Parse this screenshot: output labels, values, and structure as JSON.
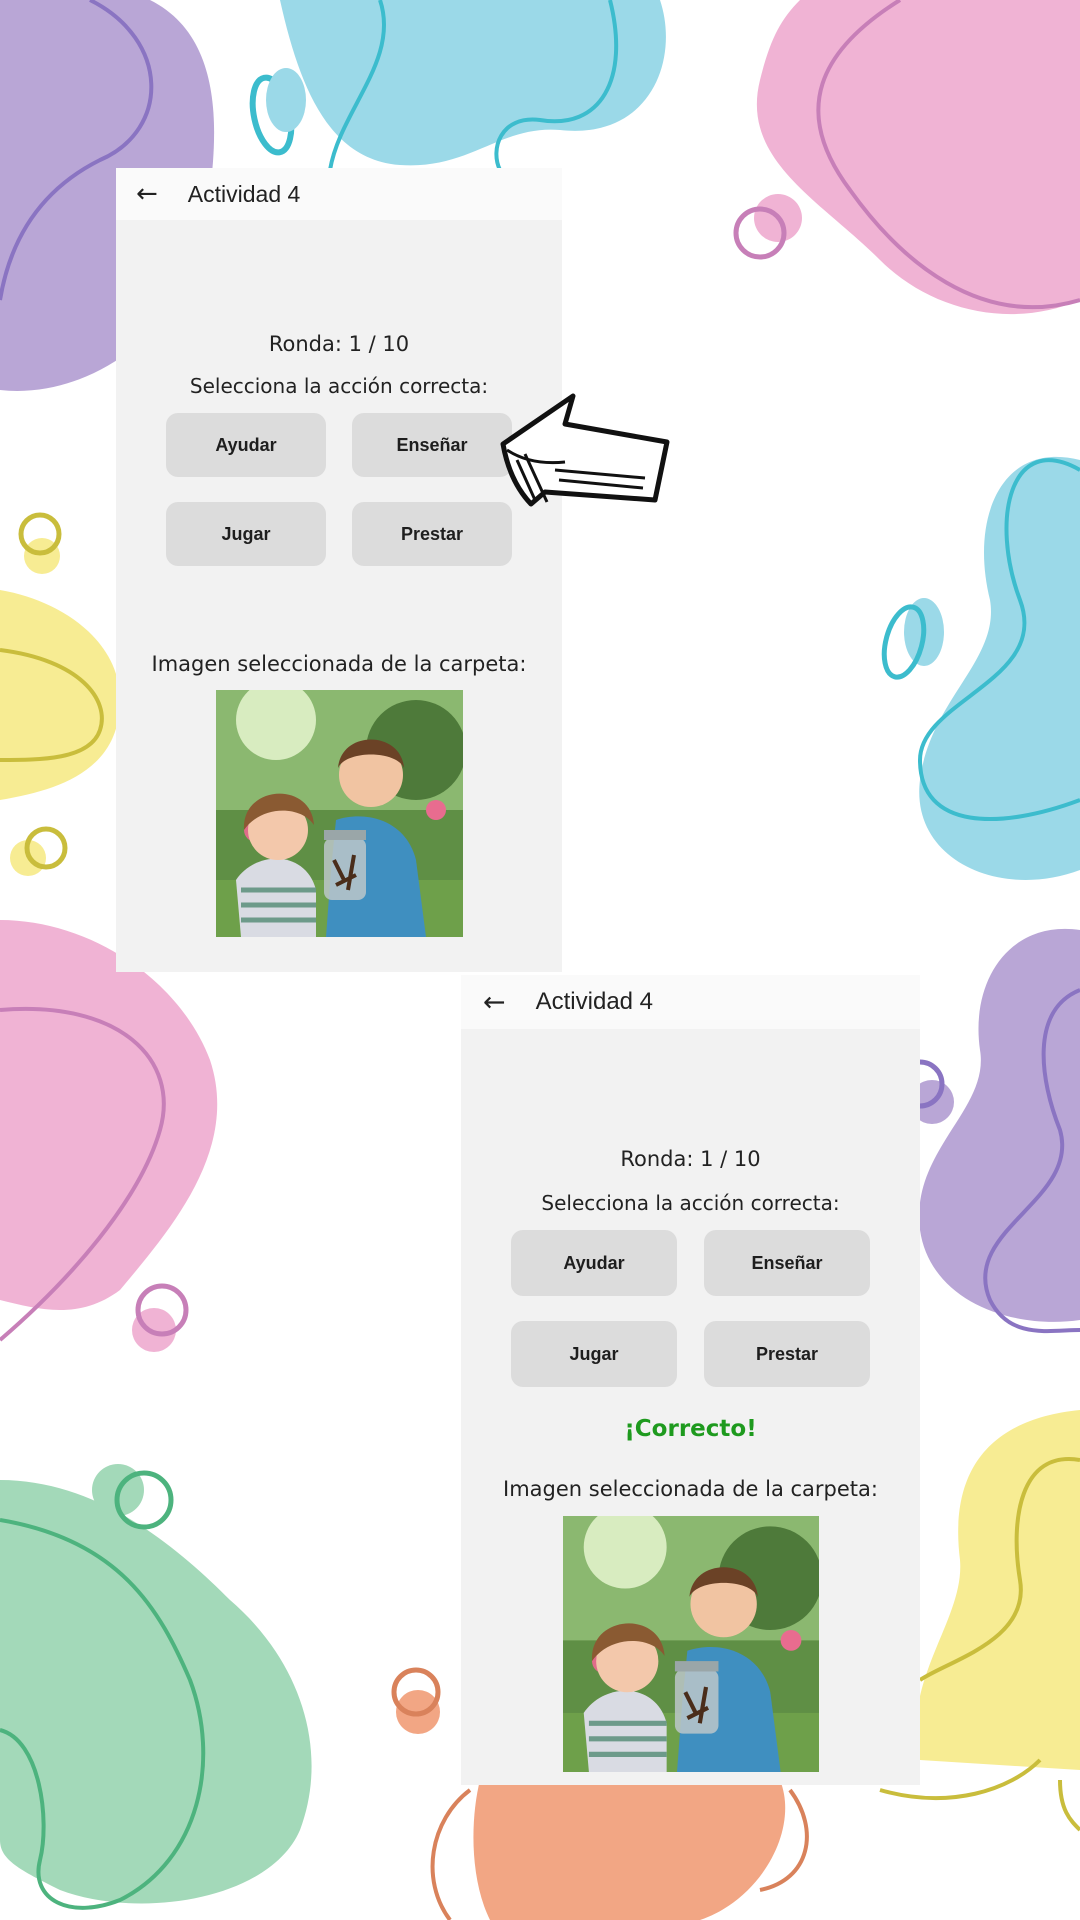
{
  "colors": {
    "screen_bg": "#f2f2f2",
    "button_bg": "#dcdcdc",
    "correct_green": "#1e9a1e",
    "blob_purple": "#b9a6d6",
    "blob_blue": "#9bd9e8",
    "blob_pink": "#f0b3d4",
    "blob_yellow": "#f7ec93",
    "blob_green": "#a3d9b9",
    "blob_orange": "#f2a684"
  },
  "screens": [
    {
      "back_icon": "arrow-left-icon",
      "title": "Actividad 4",
      "round": "Ronda: 1 / 10",
      "prompt": "Selecciona la acción correcta:",
      "buttons": [
        "Ayudar",
        "Enseñar",
        "Jugar",
        "Prestar"
      ],
      "feedback": "",
      "image_caption": "Imagen seleccionada de la carpeta:"
    },
    {
      "back_icon": "arrow-left-icon",
      "title": "Actividad 4",
      "round": "Ronda: 1 / 10",
      "prompt": "Selecciona la acción correcta:",
      "buttons": [
        "Ayudar",
        "Enseñar",
        "Jugar",
        "Prestar"
      ],
      "feedback": "¡Correcto!",
      "image_caption": "Imagen seleccionada de la carpeta:"
    }
  ],
  "annotation": {
    "pointer_icon": "hand-drawn-arrow-icon"
  }
}
